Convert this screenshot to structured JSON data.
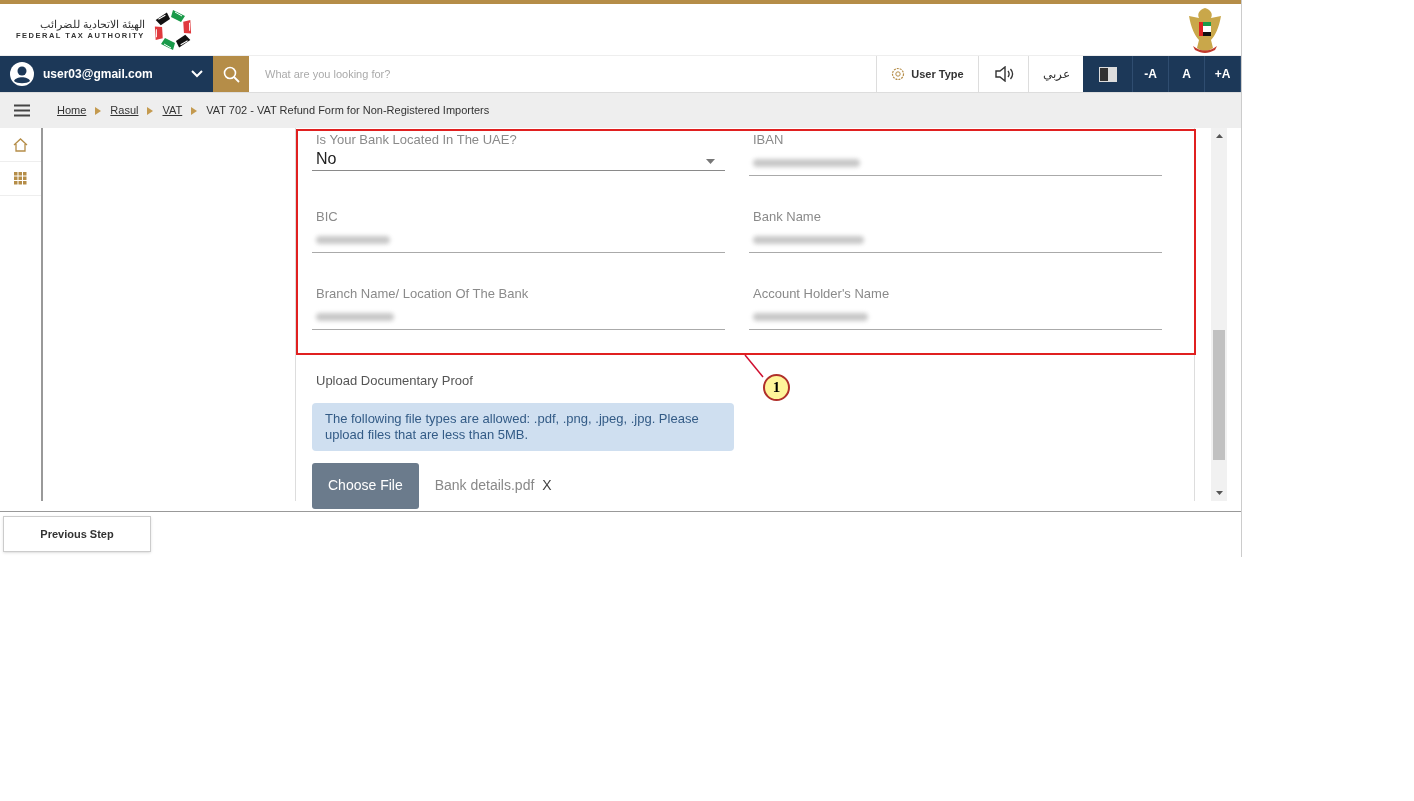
{
  "header": {
    "logo_arabic": "الهيئة الاتحادية للضرائب",
    "logo_english": "FEDERAL TAX AUTHORITY"
  },
  "toolbar": {
    "user": "user03@gmail.com",
    "search_placeholder": "What are you looking for?",
    "user_type": "User Type",
    "language": "عربي",
    "font_buttons": [
      "-A",
      "A",
      "+A"
    ]
  },
  "breadcrumb": [
    {
      "label": "Home",
      "link": true
    },
    {
      "label": "Rasul",
      "link": true
    },
    {
      "label": "VAT",
      "link": true
    },
    {
      "label": "VAT 702 - VAT Refund Form for Non-Registered Importers",
      "link": false
    }
  ],
  "form": {
    "fields": [
      {
        "label": "Is Your Bank Located In The UAE?",
        "kind": "select",
        "value": "No"
      },
      {
        "label": "IBAN",
        "kind": "redacted"
      },
      {
        "label": "BIC",
        "kind": "redacted"
      },
      {
        "label": "Bank Name",
        "kind": "redacted"
      },
      {
        "label": "Branch Name/ Location Of The Bank",
        "kind": "redacted"
      },
      {
        "label": "Account Holder's Name",
        "kind": "redacted"
      }
    ],
    "upload": {
      "label": "Upload Documentary Proof",
      "notice": "The following file types are allowed: .pdf, .png, .jpeg, .jpg. Please upload files that are less than 5MB.",
      "button": "Choose File",
      "file_name": "Bank details.pdf",
      "remove": "X"
    }
  },
  "annotation": {
    "number": "1"
  },
  "footer": {
    "previous_button": "Previous Step"
  }
}
